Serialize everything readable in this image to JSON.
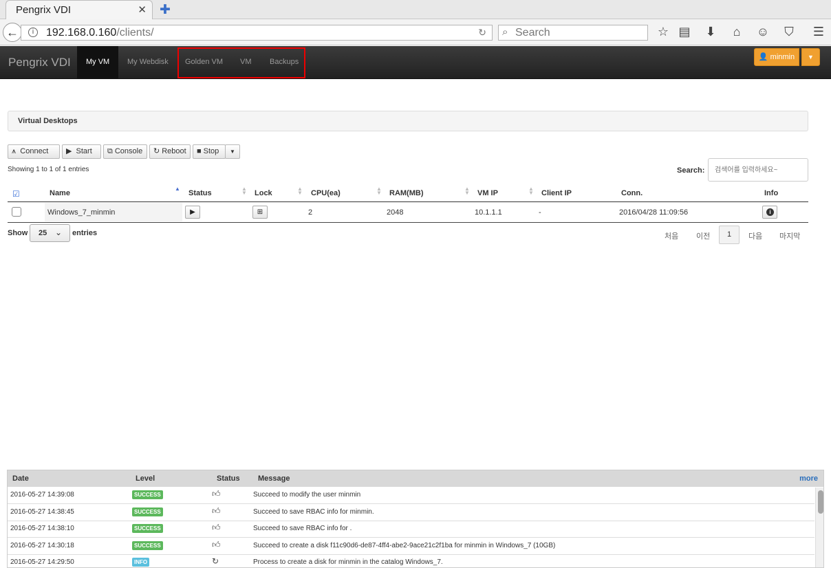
{
  "browser": {
    "tab_title": "Pengrix VDI",
    "url_host": "192.168.0.160",
    "url_path": "/clients/",
    "search_placeholder": "Search"
  },
  "appnav": {
    "brand": "Pengrix VDI",
    "items": [
      "My VM",
      "My Webdisk",
      "Golden VM",
      "VM",
      "Backups"
    ],
    "active": "My VM",
    "user": "minmin",
    "highlight_color": "#ee0000",
    "accent": "#f0a030"
  },
  "panel": {
    "title": "Virtual Desktops"
  },
  "toolbar": {
    "connect": "Connect",
    "start": "Start",
    "console": "Console",
    "reboot": "Reboot",
    "stop": "Stop"
  },
  "table": {
    "showing": "Showing 1 to 1 of 1 entries",
    "search_label": "Search:",
    "search_placeholder": "검색어를 입력하세요~",
    "columns": [
      "Name",
      "Status",
      "Lock",
      "CPU(ea)",
      "RAM(MB)",
      "VM IP",
      "Client IP",
      "Conn.",
      "Info"
    ],
    "rows": [
      {
        "name": "Windows_7_minmin",
        "cpu": "2",
        "ram": "2048",
        "vm_ip": "10.1.1.1",
        "client_ip": "-",
        "conn": "2016/04/28 11:09:56"
      }
    ],
    "show_label": "Show",
    "show_value": "25",
    "entries_label": "entries",
    "pagination": {
      "first": "처음",
      "prev": "이전",
      "current": "1",
      "next": "다음",
      "last": "마지막"
    }
  },
  "log": {
    "columns": [
      "Date",
      "Level",
      "Status",
      "Message"
    ],
    "more": "more",
    "rows": [
      {
        "date": "2016-05-27 14:39:08",
        "level": "SUCCESS",
        "message": "Succeed to modify the user minmin"
      },
      {
        "date": "2016-05-27 14:38:45",
        "level": "SUCCESS",
        "message": "Succeed to save RBAC info for minmin."
      },
      {
        "date": "2016-05-27 14:38:10",
        "level": "SUCCESS",
        "message": "Succeed to save RBAC info for ."
      },
      {
        "date": "2016-05-27 14:30:18",
        "level": "SUCCESS",
        "message": "Succeed to create a disk f11c90d6-de87-4ff4-abe2-9ace21c2f1ba for minmin in Windows_7 (10GB)"
      },
      {
        "date": "2016-05-27 14:29:50",
        "level": "INFO",
        "message": "Process to create a disk for minmin in the catalog Windows_7."
      }
    ],
    "level_colors": {
      "SUCCESS": "#5cb85c",
      "INFO": "#5bc0de"
    }
  }
}
